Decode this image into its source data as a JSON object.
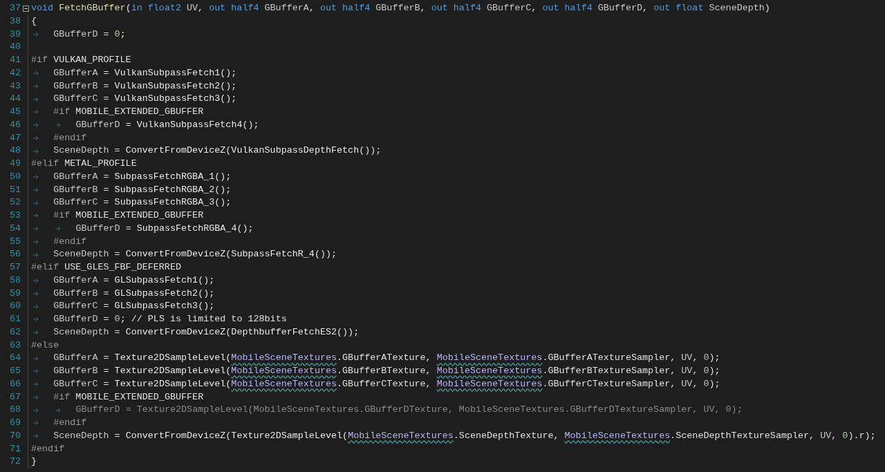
{
  "editor": {
    "lines": [
      {
        "number": "37",
        "dimmed": false,
        "tokens": [
          {
            "kind": "kw",
            "text": "void "
          },
          {
            "kind": "fn",
            "text": "FetchGBuffer"
          },
          {
            "kind": "p",
            "text": "("
          },
          {
            "kind": "kw",
            "text": "in float2"
          },
          {
            "kind": "id",
            "text": " UV"
          },
          {
            "kind": "p",
            "text": ", "
          },
          {
            "kind": "kw",
            "text": "out half4"
          },
          {
            "kind": "id",
            "text": " GBufferA"
          },
          {
            "kind": "p",
            "text": ", "
          },
          {
            "kind": "kw",
            "text": "out half4"
          },
          {
            "kind": "id",
            "text": " GBufferB"
          },
          {
            "kind": "p",
            "text": ", "
          },
          {
            "kind": "kw",
            "text": "out half4"
          },
          {
            "kind": "id",
            "text": " GBufferC"
          },
          {
            "kind": "p",
            "text": ", "
          },
          {
            "kind": "kw",
            "text": "out half4"
          },
          {
            "kind": "id",
            "text": " GBufferD"
          },
          {
            "kind": "p",
            "text": ", "
          },
          {
            "kind": "kw",
            "text": "out float"
          },
          {
            "kind": "id",
            "text": " SceneDepth"
          },
          {
            "kind": "p",
            "text": ")"
          }
        ]
      },
      {
        "number": "38",
        "dimmed": false,
        "tokens": [
          {
            "kind": "p",
            "text": "{"
          }
        ]
      },
      {
        "number": "39",
        "dimmed": false,
        "tokens": [
          {
            "kind": "id",
            "text": "\tGBufferD"
          },
          {
            "kind": "p",
            "text": " = "
          },
          {
            "kind": "num",
            "text": "0"
          },
          {
            "kind": "p",
            "text": ";"
          }
        ]
      },
      {
        "number": "40"
      },
      {
        "number": "41",
        "dimmed": false,
        "tokens": [
          {
            "kind": "pp",
            "text": "#if "
          },
          {
            "kind": "mac",
            "text": "VULKAN_PROFILE"
          }
        ]
      },
      {
        "number": "42",
        "dimmed": false,
        "tokens": [
          {
            "kind": "id",
            "text": "\tGBufferA"
          },
          {
            "kind": "p",
            "text": " = "
          },
          {
            "kind": "call",
            "text": "VulkanSubpassFetch1"
          },
          {
            "kind": "p",
            "text": "();"
          }
        ]
      },
      {
        "number": "43",
        "dimmed": false,
        "tokens": [
          {
            "kind": "id",
            "text": "\tGBufferB"
          },
          {
            "kind": "p",
            "text": " = "
          },
          {
            "kind": "call",
            "text": "VulkanSubpassFetch2"
          },
          {
            "kind": "p",
            "text": "();"
          }
        ]
      },
      {
        "number": "44",
        "dimmed": false,
        "tokens": [
          {
            "kind": "id",
            "text": "\tGBufferC"
          },
          {
            "kind": "p",
            "text": " = "
          },
          {
            "kind": "call",
            "text": "VulkanSubpassFetch3"
          },
          {
            "kind": "p",
            "text": "();"
          }
        ]
      },
      {
        "number": "45",
        "dimmed": false,
        "tokens": [
          {
            "kind": "pp",
            "text": "\t#if "
          },
          {
            "kind": "mac",
            "text": "MOBILE_EXTENDED_GBUFFER"
          }
        ]
      },
      {
        "number": "46",
        "dimmed": false,
        "tokens": [
          {
            "kind": "id",
            "text": "\t\tGBufferD"
          },
          {
            "kind": "p",
            "text": " = "
          },
          {
            "kind": "call",
            "text": "VulkanSubpassFetch4"
          },
          {
            "kind": "p",
            "text": "();"
          }
        ]
      },
      {
        "number": "47",
        "dimmed": false,
        "tokens": [
          {
            "kind": "pp",
            "text": "\t#endif"
          }
        ]
      },
      {
        "number": "48",
        "dimmed": false,
        "tokens": [
          {
            "kind": "id",
            "text": "\tSceneDepth"
          },
          {
            "kind": "p",
            "text": " = "
          },
          {
            "kind": "call",
            "text": "ConvertFromDeviceZ"
          },
          {
            "kind": "p",
            "text": "("
          },
          {
            "kind": "call",
            "text": "VulkanSubpassDepthFetch"
          },
          {
            "kind": "p",
            "text": "());"
          }
        ]
      },
      {
        "number": "49",
        "dimmed": false,
        "tokens": [
          {
            "kind": "pp",
            "text": "#elif "
          },
          {
            "kind": "mac",
            "text": "METAL_PROFILE"
          }
        ]
      },
      {
        "number": "50",
        "dimmed": false,
        "tokens": [
          {
            "kind": "id",
            "text": "\tGBufferA"
          },
          {
            "kind": "p",
            "text": " = "
          },
          {
            "kind": "call",
            "text": "SubpassFetchRGBA_1"
          },
          {
            "kind": "p",
            "text": "();"
          }
        ]
      },
      {
        "number": "51",
        "dimmed": false,
        "tokens": [
          {
            "kind": "id",
            "text": "\tGBufferB"
          },
          {
            "kind": "p",
            "text": " = "
          },
          {
            "kind": "call",
            "text": "SubpassFetchRGBA_2"
          },
          {
            "kind": "p",
            "text": "();"
          }
        ]
      },
      {
        "number": "52",
        "dimmed": false,
        "tokens": [
          {
            "kind": "id",
            "text": "\tGBufferC"
          },
          {
            "kind": "p",
            "text": " = "
          },
          {
            "kind": "call",
            "text": "SubpassFetchRGBA_3"
          },
          {
            "kind": "p",
            "text": "();"
          }
        ]
      },
      {
        "number": "53",
        "dimmed": false,
        "tokens": [
          {
            "kind": "pp",
            "text": "\t#if "
          },
          {
            "kind": "mac",
            "text": "MOBILE_EXTENDED_GBUFFER"
          }
        ]
      },
      {
        "number": "54",
        "dimmed": false,
        "tokens": [
          {
            "kind": "id",
            "text": "\t\tGBufferD"
          },
          {
            "kind": "p",
            "text": " = "
          },
          {
            "kind": "call",
            "text": "SubpassFetchRGBA_4"
          },
          {
            "kind": "p",
            "text": "();"
          }
        ]
      },
      {
        "number": "55",
        "dimmed": false,
        "tokens": [
          {
            "kind": "pp",
            "text": "\t#endif"
          }
        ]
      },
      {
        "number": "56",
        "dimmed": false,
        "tokens": [
          {
            "kind": "id",
            "text": "\tSceneDepth"
          },
          {
            "kind": "p",
            "text": " = "
          },
          {
            "kind": "call",
            "text": "ConvertFromDeviceZ"
          },
          {
            "kind": "p",
            "text": "("
          },
          {
            "kind": "call",
            "text": "SubpassFetchR_4"
          },
          {
            "kind": "p",
            "text": "());"
          }
        ]
      },
      {
        "number": "57",
        "dimmed": false,
        "tokens": [
          {
            "kind": "pp",
            "text": "#elif "
          },
          {
            "kind": "mac",
            "text": "USE_GLES_FBF_DEFERRED"
          }
        ]
      },
      {
        "number": "58",
        "dimmed": false,
        "tokens": [
          {
            "kind": "id",
            "text": "\tGBufferA"
          },
          {
            "kind": "p",
            "text": " = "
          },
          {
            "kind": "call",
            "text": "GLSubpassFetch1"
          },
          {
            "kind": "p",
            "text": "();"
          }
        ]
      },
      {
        "number": "59",
        "dimmed": false,
        "tokens": [
          {
            "kind": "id",
            "text": "\tGBufferB"
          },
          {
            "kind": "p",
            "text": " = "
          },
          {
            "kind": "call",
            "text": "GLSubpassFetch2"
          },
          {
            "kind": "p",
            "text": "();"
          }
        ]
      },
      {
        "number": "60",
        "dimmed": false,
        "tokens": [
          {
            "kind": "id",
            "text": "\tGBufferC"
          },
          {
            "kind": "p",
            "text": " = "
          },
          {
            "kind": "call",
            "text": "GLSubpassFetch3"
          },
          {
            "kind": "p",
            "text": "();"
          }
        ]
      },
      {
        "number": "61",
        "dimmed": false,
        "tokens": [
          {
            "kind": "id",
            "text": "\tGBufferD"
          },
          {
            "kind": "p",
            "text": " = "
          },
          {
            "kind": "num",
            "text": "0"
          },
          {
            "kind": "p",
            "text": "; // PLS is limited to 128bits"
          }
        ]
      },
      {
        "number": "62",
        "dimmed": false,
        "tokens": [
          {
            "kind": "id",
            "text": "\tSceneDepth"
          },
          {
            "kind": "p",
            "text": " = "
          },
          {
            "kind": "call",
            "text": "ConvertFromDeviceZ"
          },
          {
            "kind": "p",
            "text": "("
          },
          {
            "kind": "call",
            "text": "DepthbufferFetchES2"
          },
          {
            "kind": "p",
            "text": "());"
          }
        ]
      },
      {
        "number": "63",
        "dimmed": false,
        "tokens": [
          {
            "kind": "pp",
            "text": "#else"
          }
        ]
      },
      {
        "number": "64",
        "dimmed": false,
        "tokens": [
          {
            "kind": "id",
            "text": "\tGBufferA"
          },
          {
            "kind": "p",
            "text": " = "
          },
          {
            "kind": "call",
            "text": "Texture2DSampleLevel"
          },
          {
            "kind": "p",
            "text": "("
          },
          {
            "kind": "type",
            "text": "MobileSceneTextures"
          },
          {
            "kind": "p",
            "text": ".GBufferATexture, "
          },
          {
            "kind": "type",
            "text": "MobileSceneTextures"
          },
          {
            "kind": "p",
            "text": ".GBufferATextureSampler, "
          },
          {
            "kind": "id",
            "text": "UV"
          },
          {
            "kind": "p",
            "text": ", "
          },
          {
            "kind": "num",
            "text": "0"
          },
          {
            "kind": "p",
            "text": ");"
          }
        ]
      },
      {
        "number": "65",
        "dimmed": false,
        "tokens": [
          {
            "kind": "id",
            "text": "\tGBufferB"
          },
          {
            "kind": "p",
            "text": " = "
          },
          {
            "kind": "call",
            "text": "Texture2DSampleLevel"
          },
          {
            "kind": "p",
            "text": "("
          },
          {
            "kind": "type",
            "text": "MobileSceneTextures"
          },
          {
            "kind": "p",
            "text": ".GBufferBTexture, "
          },
          {
            "kind": "type",
            "text": "MobileSceneTextures"
          },
          {
            "kind": "p",
            "text": ".GBufferBTextureSampler, "
          },
          {
            "kind": "id",
            "text": "UV"
          },
          {
            "kind": "p",
            "text": ", "
          },
          {
            "kind": "num",
            "text": "0"
          },
          {
            "kind": "p",
            "text": ");"
          }
        ]
      },
      {
        "number": "66",
        "dimmed": false,
        "tokens": [
          {
            "kind": "id",
            "text": "\tGBufferC"
          },
          {
            "kind": "p",
            "text": " = "
          },
          {
            "kind": "call",
            "text": "Texture2DSampleLevel"
          },
          {
            "kind": "p",
            "text": "("
          },
          {
            "kind": "type",
            "text": "MobileSceneTextures"
          },
          {
            "kind": "p",
            "text": ".GBufferCTexture, "
          },
          {
            "kind": "type",
            "text": "MobileSceneTextures"
          },
          {
            "kind": "p",
            "text": ".GBufferCTextureSampler, "
          },
          {
            "kind": "id",
            "text": "UV"
          },
          {
            "kind": "p",
            "text": ", "
          },
          {
            "kind": "num",
            "text": "0"
          },
          {
            "kind": "p",
            "text": ");"
          }
        ]
      },
      {
        "number": "67",
        "dimmed": false,
        "tokens": [
          {
            "kind": "pp",
            "text": "\t#if "
          },
          {
            "kind": "mac",
            "text": "MOBILE_EXTENDED_GBUFFER"
          }
        ]
      },
      {
        "number": "68",
        "dimmed": true,
        "tokens": [
          {
            "kind": "id",
            "text": "\t\tGBufferD"
          },
          {
            "kind": "p",
            "text": " = "
          },
          {
            "kind": "call",
            "text": "Texture2DSampleLevel"
          },
          {
            "kind": "p",
            "text": "(MobileSceneTextures.GBufferDTexture, MobileSceneTextures.GBufferDTextureSampler, UV, 0);"
          }
        ]
      },
      {
        "number": "69",
        "dimmed": false,
        "tokens": [
          {
            "kind": "pp",
            "text": "\t#endif"
          }
        ]
      },
      {
        "number": "70",
        "dimmed": false,
        "tokens": [
          {
            "kind": "id",
            "text": "\tSceneDepth"
          },
          {
            "kind": "p",
            "text": " = "
          },
          {
            "kind": "call",
            "text": "ConvertFromDeviceZ"
          },
          {
            "kind": "p",
            "text": "("
          },
          {
            "kind": "call",
            "text": "Texture2DSampleLevel"
          },
          {
            "kind": "p",
            "text": "("
          },
          {
            "kind": "type",
            "text": "MobileSceneTextures"
          },
          {
            "kind": "p",
            "text": ".SceneDepthTexture, "
          },
          {
            "kind": "type",
            "text": "MobileSceneTextures"
          },
          {
            "kind": "p",
            "text": ".SceneDepthTextureSampler, "
          },
          {
            "kind": "id",
            "text": "UV"
          },
          {
            "kind": "p",
            "text": ", "
          },
          {
            "kind": "num",
            "text": "0"
          },
          {
            "kind": "p",
            "text": ").r);"
          }
        ]
      },
      {
        "number": "71",
        "dimmed": false,
        "tokens": [
          {
            "kind": "pp",
            "text": "#endif"
          }
        ]
      },
      {
        "number": "72",
        "dimmed": false,
        "tokens": [
          {
            "kind": "p",
            "text": "}"
          }
        ]
      }
    ]
  }
}
